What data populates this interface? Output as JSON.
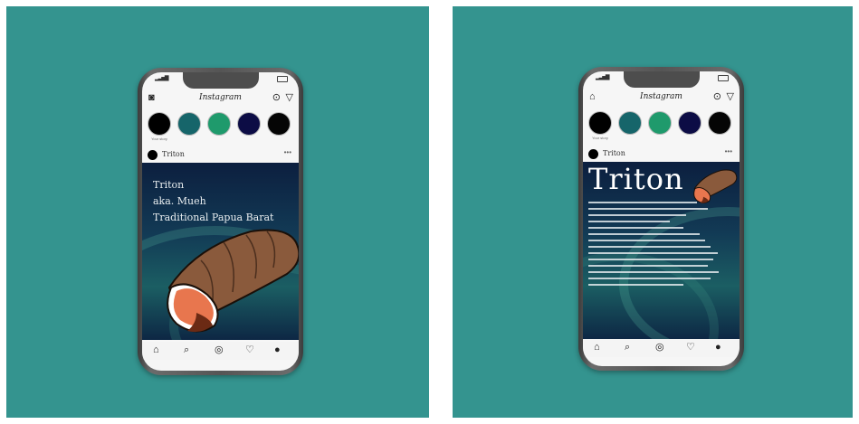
{
  "left_mockup": {
    "app_title": "Instagram",
    "post_username": "Triton",
    "caption_lines": [
      "Triton",
      "aka. Mueh",
      "Traditional Papua Barat"
    ],
    "stories": [
      {
        "label": "Your story",
        "color": "#000000"
      },
      {
        "label": "",
        "color": "#16656a"
      },
      {
        "label": "",
        "color": "#1f9a6c"
      },
      {
        "label": "",
        "color": "#0c0c45"
      },
      {
        "label": "",
        "color": "#050505"
      }
    ]
  },
  "right_mockup": {
    "app_title": "Instagram",
    "post_username": "Triton",
    "big_title": "Triton",
    "stories": [
      {
        "label": "Your story",
        "color": "#000000"
      },
      {
        "label": "",
        "color": "#16656a"
      },
      {
        "label": "",
        "color": "#1f9a6c"
      },
      {
        "label": "",
        "color": "#0c0c45"
      },
      {
        "label": "",
        "color": "#050505"
      }
    ]
  },
  "colors": {
    "background": "#34948f",
    "shell_outer": "#8a5a3c",
    "shell_inner": "#e8764e",
    "shell_lip": "#6b2a14"
  },
  "icons": {
    "camera": "camera-icon",
    "igtv": "igtv-icon",
    "direct": "direct-message-icon",
    "home": "home-icon",
    "search": "search-icon",
    "reels": "reels-icon",
    "shop": "shop-icon",
    "profile": "profile-icon"
  }
}
